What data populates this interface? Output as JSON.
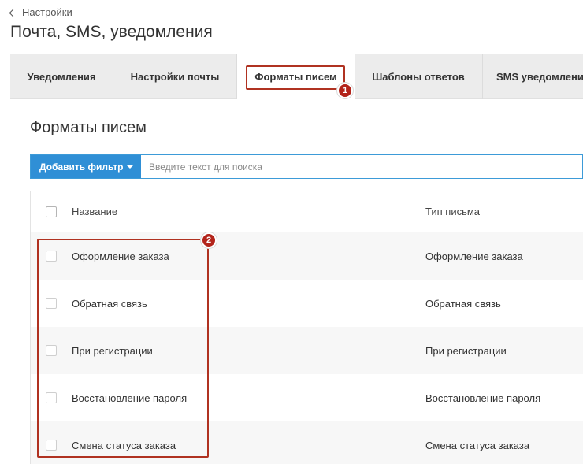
{
  "breadcrumb": {
    "back_label": "Настройки"
  },
  "page": {
    "title": "Почта, SMS, уведомления"
  },
  "tabs": [
    {
      "label": "Уведомления"
    },
    {
      "label": "Настройки почты"
    },
    {
      "label": "Форматы писем"
    },
    {
      "label": "Шаблоны ответов"
    },
    {
      "label": "SMS уведомления"
    }
  ],
  "badges": {
    "one": "1",
    "two": "2"
  },
  "section": {
    "title": "Форматы писем"
  },
  "filter": {
    "add_filter_label": "Добавить фильтр",
    "search_placeholder": "Введите текст для поиска"
  },
  "table": {
    "columns": [
      "Название",
      "Тип письма"
    ],
    "rows": [
      {
        "name": "Оформление заказа",
        "type": "Оформление заказа"
      },
      {
        "name": "Обратная связь",
        "type": "Обратная связь"
      },
      {
        "name": "При регистрации",
        "type": "При регистрации"
      },
      {
        "name": "Восстановление пароля",
        "type": "Восстановление пароля"
      },
      {
        "name": "Смена статуса заказа",
        "type": "Смена статуса заказа"
      }
    ]
  },
  "colors": {
    "accent": "#2f8fd6",
    "annotation": "#b03221",
    "tab_bar": "#ececec"
  },
  "icons": {
    "back": "chevron-left-icon",
    "dropdown": "caret-down-icon"
  }
}
